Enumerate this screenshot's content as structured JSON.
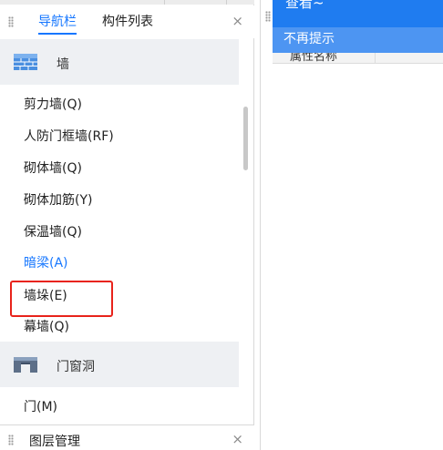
{
  "nav_panel": {
    "tabs": [
      {
        "label": "导航栏",
        "active": true
      },
      {
        "label": "构件列表",
        "active": false
      }
    ],
    "close_glyph": "×",
    "groups": [
      {
        "label": "墙",
        "icon": "wall-icon",
        "items": [
          {
            "label": "剪力墙(Q)"
          },
          {
            "label": "人防门框墙(RF)"
          },
          {
            "label": "砌体墙(Q)"
          },
          {
            "label": "砌体加筋(Y)"
          },
          {
            "label": "保温墙(Q)"
          },
          {
            "label": "暗梁(A)",
            "active": true
          },
          {
            "label": "墙垛(E)"
          },
          {
            "label": "幕墙(Q)"
          }
        ]
      },
      {
        "label": "门窗洞",
        "icon": "door-window-opening-icon",
        "items": [
          {
            "label": "门(M)"
          }
        ]
      }
    ]
  },
  "layer_panel": {
    "title": "图层管理",
    "close_glyph": "×"
  },
  "properties_panel": {
    "column_header": "属性名称"
  },
  "toast": {
    "message": "查看~",
    "dismiss_label": "不再提示"
  },
  "colors": {
    "accent": "#1677ff",
    "toast": "#1f7cf0",
    "highlight": "#e8231b"
  }
}
